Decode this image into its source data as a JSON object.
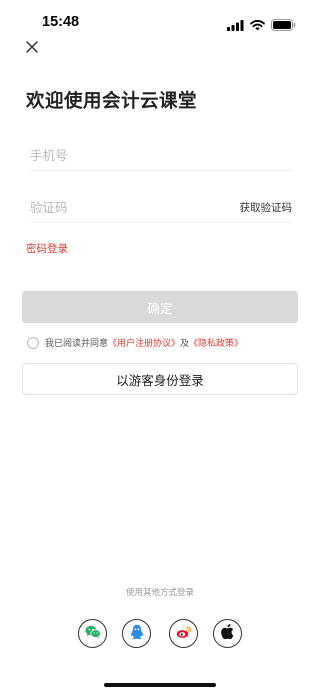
{
  "status_bar": {
    "time": "15:48",
    "icons": [
      "cellular-signal-icon",
      "wifi-icon",
      "battery-icon"
    ]
  },
  "header": {
    "close_icon": "close-icon",
    "title": "欢迎使用会计云课堂"
  },
  "form": {
    "phone_placeholder": "手机号",
    "phone_value": "",
    "code_placeholder": "验证码",
    "code_value": "",
    "get_code_label": "获取验证码",
    "password_login_label": "密码登录"
  },
  "actions": {
    "confirm_label": "确定",
    "guest_login_label": "以游客身份登录"
  },
  "agreement": {
    "checked": false,
    "prefix": "我已阅读并同意",
    "user_agreement": "《用户注册协议》",
    "conjunction": "及",
    "privacy_policy": "《隐私政策》"
  },
  "other_login": {
    "label": "使用其他方式登录",
    "providers": [
      "wechat-icon",
      "qq-icon",
      "weibo-icon",
      "apple-icon"
    ]
  },
  "colors": {
    "accent_red": "#d2413a",
    "disabled_button": "#d9d9d9",
    "placeholder": "#b9b9b9",
    "wechat_green": "#2aae67",
    "qq_blue": "#2b8fe6",
    "weibo_red": "#e6162d"
  }
}
